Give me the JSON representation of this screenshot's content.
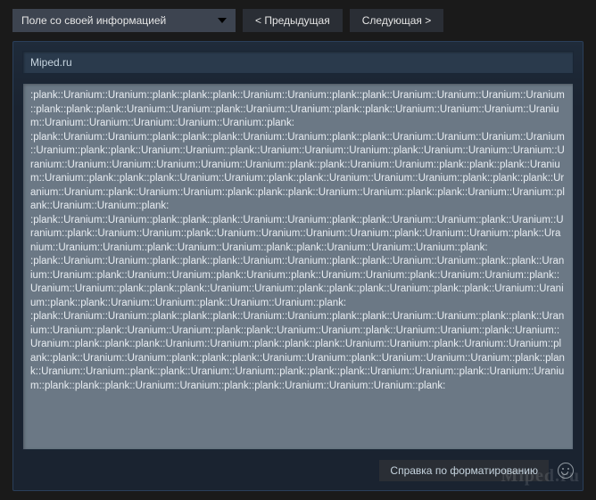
{
  "toolbar": {
    "dropdown_label": "Поле со своей информацией",
    "prev_label": "< Предыдущая",
    "next_label": "Следующая >"
  },
  "editor": {
    "title_value": "Miped.ru",
    "body_value": ":plank::Uranium::Uranium::plank::plank::plank::Uranium::Uranium::plank::plank::Uranium::Uranium::Uranium::Uranium::plank::plank::plank::Uranium::Uranium::plank::Uranium::Uranium::plank::plank::Uranium::Uranium::Uranium::Uranium::Uranium::Uranium::Uranium::Uranium::Uranium::plank:\n:plank::Uranium::Uranium::plank::plank::plank::Uranium::Uranium::plank::plank::Uranium::Uranium::Uranium::Uranium::Uranium::plank::plank::Uranium::Uranium::plank::Uranium::Uranium::Uranium::plank::Uranium::Uranium::Uranium::Uranium::Uranium::Uranium::Uranium::Uranium::Uranium::plank::plank::Uranium::Uranium::plank::plank::plank::Uranium::Uranium::plank::plank::plank::Uranium::Uranium::plank::plank::Uranium::Uranium::Uranium::plank::plank::plank::Uranium::Uranium::plank::Uranium::Uranium::plank::plank::plank::Uranium::Uranium::plank::plank::Uranium::Uranium::plank::Uranium::Uranium::plank:\n:plank::Uranium::Uranium::plank::plank::plank::Uranium::Uranium::plank::plank::Uranium::Uranium::plank::Uranium::Uranium::plank::Uranium::Uranium::plank::Uranium::Uranium::Uranium::Uranium::plank::Uranium::Uranium::plank::Uranium::Uranium::Uranium::plank::Uranium::Uranium::plank::plank::Uranium::Uranium::Uranium::plank:\n:plank::Uranium::Uranium::plank::plank::plank::Uranium::Uranium::plank::plank::Uranium::Uranium::plank::plank::Uranium::Uranium::plank::Uranium::Uranium::plank::Uranium::plank::Uranium::Uranium::plank::Uranium::Uranium::plank::Uranium::Uranium::plank::plank::plank::Uranium::Uranium::plank::plank::plank::Uranium::plank::plank::Uranium::Uranium::plank::plank::Uranium::Uranium::plank::Uranium::Uranium::plank:\n:plank::Uranium::Uranium::plank::plank::plank::Uranium::Uranium::plank::plank::Uranium::Uranium::plank::plank::Uranium::Uranium::plank::Uranium::Uranium::plank::plank::Uranium::Uranium::plank::Uranium::Uranium::plank::Uranium::Uranium::plank::plank::plank::Uranium::Uranium::plank::plank::plank::Uranium::Uranium::plank::Uranium::Uranium::plank::plank::Uranium::Uranium::plank::plank::plank::Uranium::Uranium::plank::Uranium::Uranium::Uranium::plank::plank::Uranium::Uranium::plank::plank::Uranium::Uranium::plank::plank::plank::Uranium::Uranium::plank::Uranium::Uranium::plank::plank::plank::Uranium::Uranium::plank::plank::Uranium::Uranium::Uranium::plank:"
  },
  "footer": {
    "format_help_label": "Справка по форматированию"
  },
  "watermark": "Miped.ru"
}
